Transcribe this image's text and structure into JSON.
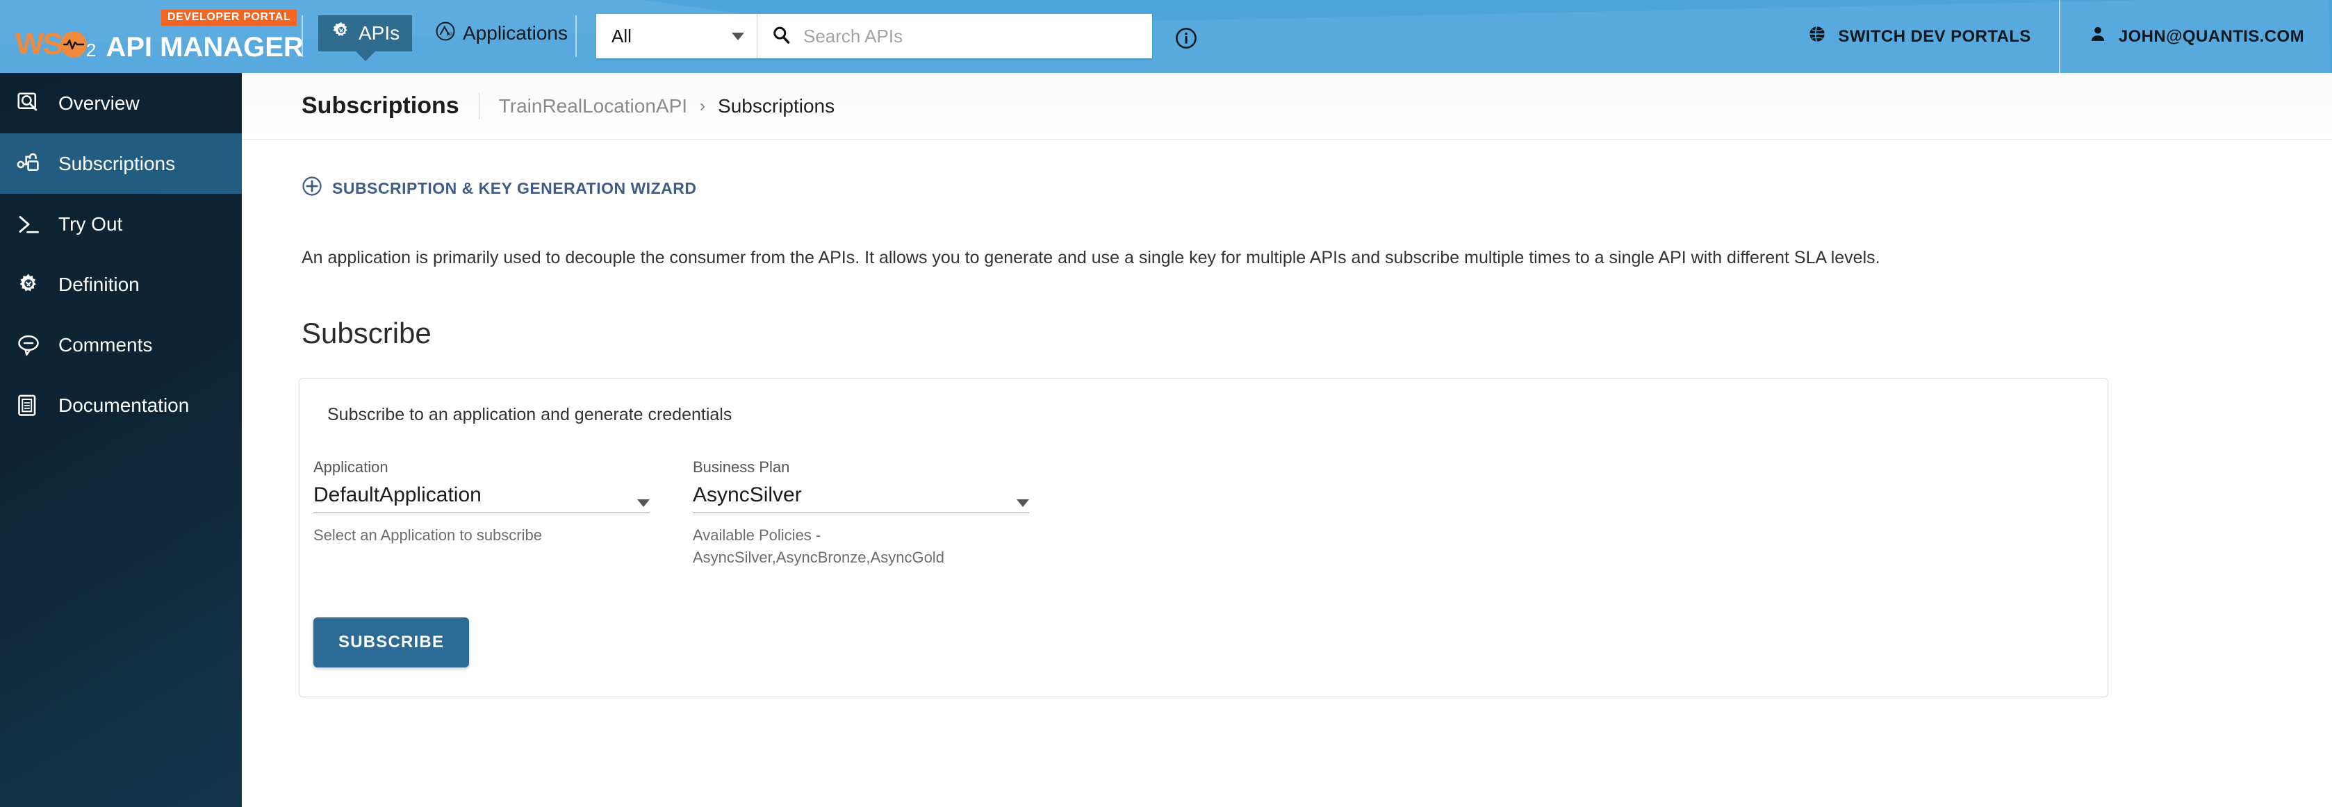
{
  "header": {
    "brand_badge": "DEVELOPER PORTAL",
    "brand_prefix": "WS",
    "brand_sub": "2",
    "brand_title": "API MANAGER",
    "tabs": [
      {
        "label": "APIs",
        "icon": "gear-icon",
        "active": true
      },
      {
        "label": "Applications",
        "icon": "application-icon",
        "active": false
      }
    ],
    "search": {
      "filter_value": "All",
      "placeholder": "Search APIs",
      "value": ""
    },
    "info_icon": "info-icon",
    "switch_portals_label": "SWITCH DEV PORTALS",
    "switch_portals_icon": "globe-icon",
    "user_label": "JOHN@QUANTIS.COM",
    "user_icon": "user-icon",
    "colors": {
      "header_bg": "#4ea5dc",
      "badge_bg": "#f26522",
      "active_tab_bg": "#2f6b8f",
      "logo_orange": "#f08a3c"
    }
  },
  "sidebar": {
    "items": [
      {
        "label": "Overview",
        "icon": "overview-search-icon",
        "active": false
      },
      {
        "label": "Subscriptions",
        "icon": "key-lock-icon",
        "active": true
      },
      {
        "label": "Try Out",
        "icon": "terminal-prompt-icon",
        "active": false
      },
      {
        "label": "Definition",
        "icon": "gear-tools-icon",
        "active": false
      },
      {
        "label": "Comments",
        "icon": "comment-bubble-icon",
        "active": false
      },
      {
        "label": "Documentation",
        "icon": "document-icon",
        "active": false
      }
    ],
    "colors": {
      "bg": "#0e2434",
      "active_bg": "#225d81"
    }
  },
  "main": {
    "page_title": "Subscriptions",
    "breadcrumb": {
      "parent": "TrainRealLocationAPI",
      "separator": "›",
      "current": "Subscriptions"
    },
    "wizard_link": {
      "label": "SUBSCRIPTION & KEY GENERATION WIZARD",
      "icon": "plus-circle-icon",
      "color": "#3f5c87"
    },
    "description": "An application is primarily used to decouple the consumer from the APIs. It allows you to generate and use a single key for multiple APIs and subscribe multiple times to a single API with different SLA levels.",
    "section_title": "Subscribe",
    "card": {
      "subtitle": "Subscribe to an application and generate credentials",
      "application_field": {
        "label": "Application",
        "value": "DefaultApplication",
        "help": "Select an Application to subscribe"
      },
      "business_plan_field": {
        "label": "Business Plan",
        "value": "AsyncSilver",
        "help_line1": "Available Policies -",
        "help_line2": "AsyncSilver,AsyncBronze,AsyncGold"
      },
      "subscribe_button": {
        "label": "SUBSCRIBE",
        "color": "#2c6b96"
      }
    }
  }
}
